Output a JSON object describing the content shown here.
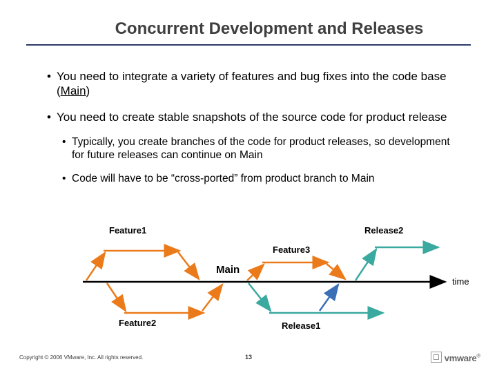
{
  "title": "Concurrent Development and Releases",
  "bullets": {
    "b1a_pre": "You need to integrate a variety of features and bug fixes into the code base (",
    "b1a_main": "Main",
    "b1a_post": ")",
    "b1b": "You need to create stable snapshots of the source code for product release",
    "b2a": "Typically, you create branches of the code for product releases, so development for future releases can continue on Main",
    "b2b": "Code will have to be “cross-ported” from product branch to Main"
  },
  "diagram": {
    "feature1": "Feature1",
    "feature2": "Feature2",
    "feature3": "Feature3",
    "release1": "Release1",
    "release2": "Release2",
    "main": "Main",
    "time": "time"
  },
  "footer": {
    "copyright": "Copyright © 2006 VMware, Inc. All rights reserved.",
    "page": "13",
    "logo": "vmware"
  }
}
